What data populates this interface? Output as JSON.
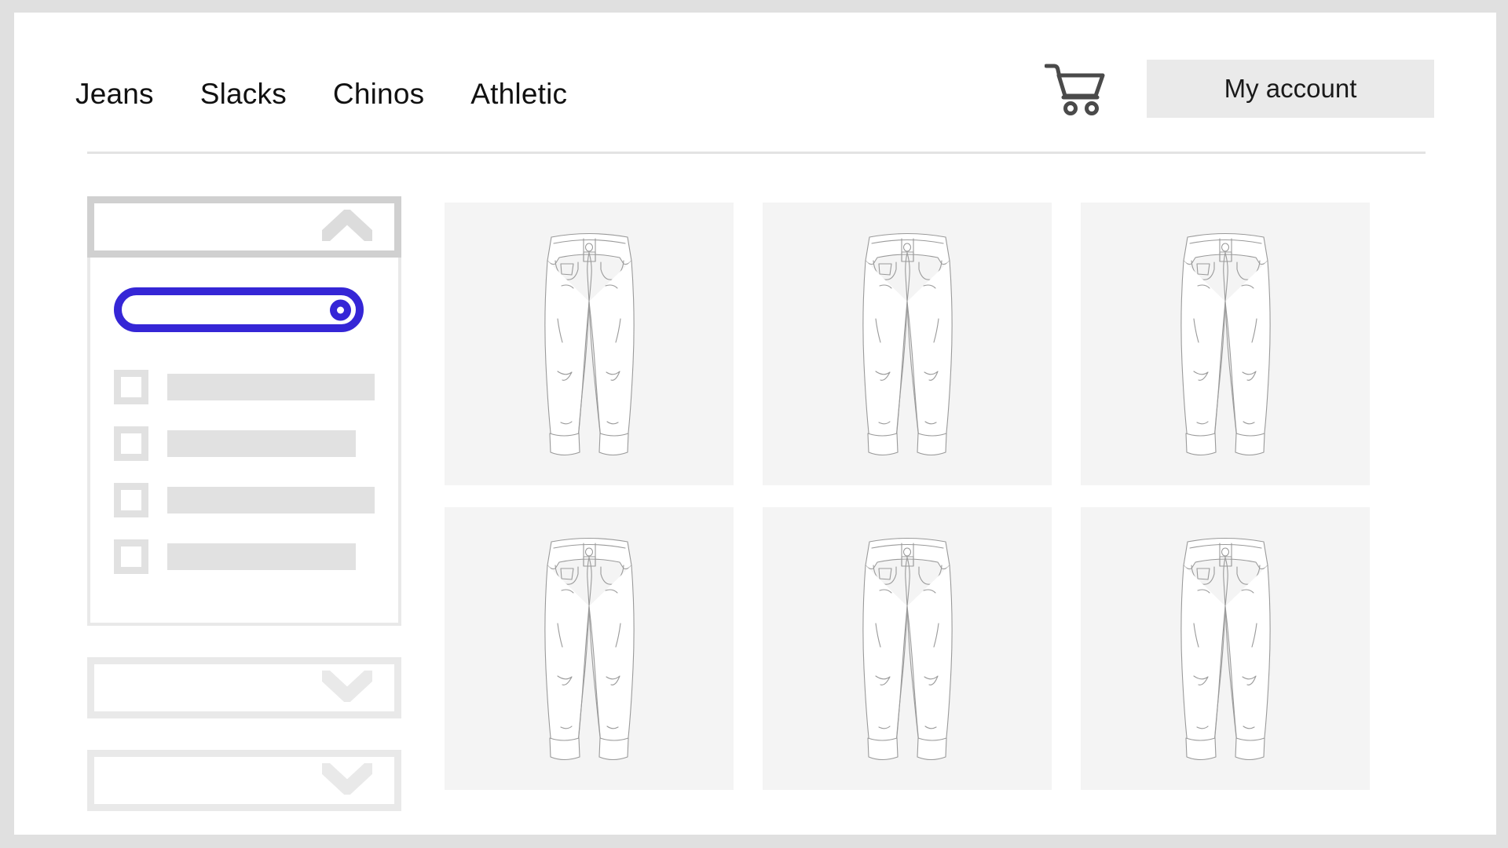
{
  "theme": {
    "page_background": "#e0e0e0",
    "card_background": "#ffffff",
    "accent_blue": "#3526d6",
    "tile_background": "#f4f4f4",
    "placeholder_gray": "#e1e1e1",
    "button_gray": "#eaeaea",
    "border_gray_dark": "#d0d0d0",
    "border_gray_light": "#e9e9e9",
    "text_color": "#111111"
  },
  "header": {
    "nav_items": [
      {
        "label": "Jeans"
      },
      {
        "label": "Slacks"
      },
      {
        "label": "Chinos"
      },
      {
        "label": "Athletic"
      }
    ],
    "cart_icon": "shopping-cart-icon",
    "account_button_label": "My account"
  },
  "sidebar": {
    "accordions": [
      {
        "state": "expanded",
        "chevron_icon": "chevron-up-icon",
        "title": "",
        "toggle": {
          "state": "on",
          "knob_position": "right"
        },
        "options": [
          {
            "checked": false,
            "label": "",
            "bar_width": "long"
          },
          {
            "checked": false,
            "label": "",
            "bar_width": "short"
          },
          {
            "checked": false,
            "label": "",
            "bar_width": "long"
          },
          {
            "checked": false,
            "label": "",
            "bar_width": "short"
          }
        ]
      },
      {
        "state": "collapsed",
        "chevron_icon": "chevron-down-icon",
        "title": ""
      },
      {
        "state": "collapsed",
        "chevron_icon": "chevron-down-icon",
        "title": ""
      }
    ]
  },
  "main": {
    "products": [
      {
        "image": "jeans-line-art",
        "label": ""
      },
      {
        "image": "jeans-line-art",
        "label": ""
      },
      {
        "image": "jeans-line-art",
        "label": ""
      },
      {
        "image": "jeans-line-art",
        "label": ""
      },
      {
        "image": "jeans-line-art",
        "label": ""
      },
      {
        "image": "jeans-line-art",
        "label": ""
      }
    ],
    "columns": 3,
    "rows": 2
  }
}
